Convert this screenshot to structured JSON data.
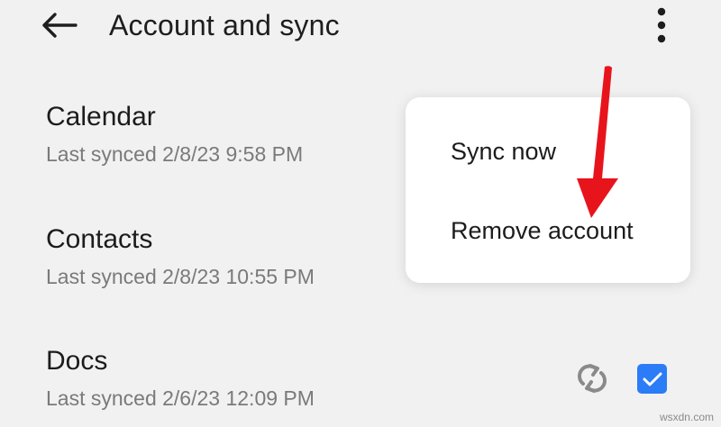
{
  "header": {
    "title": "Account and sync",
    "back_icon": "arrow-left-icon",
    "overflow_icon": "more-vertical-icon"
  },
  "sync_items": [
    {
      "title": "Calendar",
      "subtitle": "Last synced 2/8/23 9:58 PM"
    },
    {
      "title": "Contacts",
      "subtitle": "Last synced 2/8/23 10:55 PM"
    },
    {
      "title": "Docs",
      "subtitle": "Last synced 2/6/23 12:09 PM",
      "checked": true
    }
  ],
  "menu": {
    "items": [
      {
        "label": "Sync now"
      },
      {
        "label": "Remove account"
      }
    ]
  },
  "colors": {
    "background": "#f1f1f1",
    "checkbox": "#2b7cf6",
    "annotation_arrow": "#e8141c"
  },
  "watermark": "wsxdn.com"
}
